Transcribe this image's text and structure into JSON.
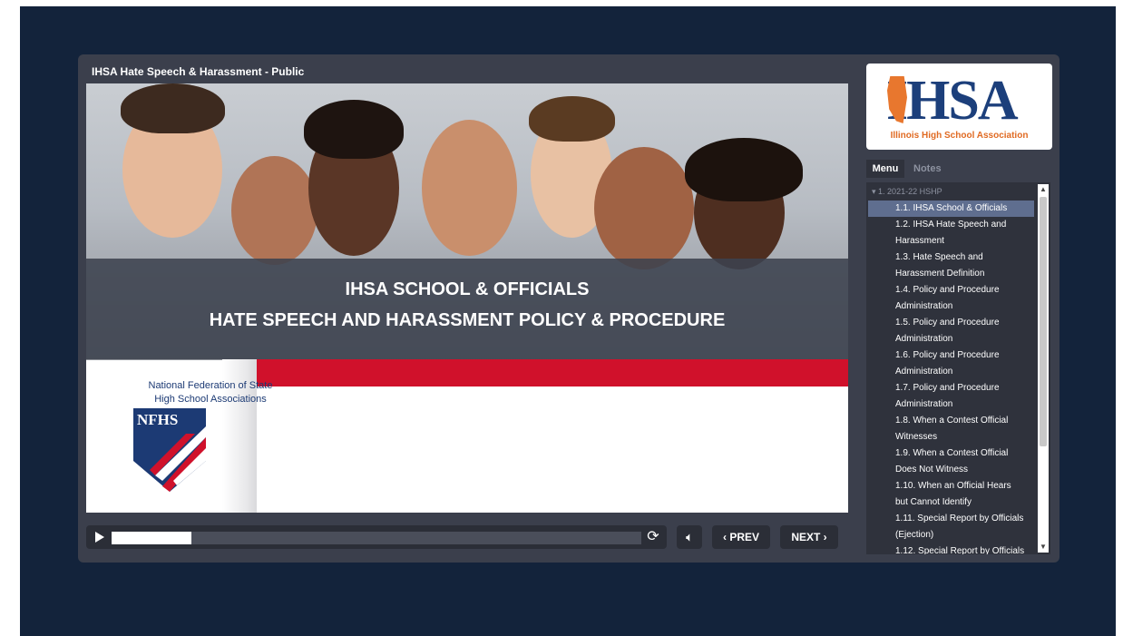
{
  "window": {
    "title": "IHSA Hate Speech & Harassment - Public"
  },
  "slide": {
    "banner_line1": "IHSA SCHOOL & OFFICIALS",
    "banner_line2": "HATE SPEECH AND HARASSMENT POLICY & PROCEDURE",
    "nfhs_text_line1": "National Federation of State",
    "nfhs_text_line2": "High School Associations",
    "nfhs_logo_text": "NFHS"
  },
  "controls": {
    "progress_fraction": 0.15,
    "prev_label": "‹ PREV",
    "next_label": "NEXT ›",
    "play_icon": "play-icon",
    "replay_icon": "replay-icon",
    "volume_icon": "volume-icon"
  },
  "sidebar": {
    "logo_text": "IHSA",
    "logo_sub": "Illinois High School Association",
    "tabs": [
      {
        "label": "Menu"
      },
      {
        "label": "Notes"
      }
    ],
    "section": "1. 2021-22 HSHP",
    "items": [
      {
        "line1": "1.1. IHSA School & Officials",
        "line2": ""
      },
      {
        "line1": "1.2. IHSA Hate Speech and",
        "line2": "Harassment"
      },
      {
        "line1": "1.3. Hate Speech and",
        "line2": "Harassment Definition"
      },
      {
        "line1": "1.4. Policy and Procedure",
        "line2": "Administration"
      },
      {
        "line1": "1.5. Policy and Procedure",
        "line2": "Administration"
      },
      {
        "line1": "1.6. Policy and Procedure",
        "line2": "Administration"
      },
      {
        "line1": "1.7. Policy and Procedure",
        "line2": "Administration"
      },
      {
        "line1": "1.8. When a Contest Official",
        "line2": "Witnesses"
      },
      {
        "line1": "1.9. When a Contest Official",
        "line2": "Does Not Witness"
      },
      {
        "line1": "1.10. When an Official Hears",
        "line2": "but Cannot Identify"
      },
      {
        "line1": "1.11. Special Report by Officials",
        "line2": "(Ejection)"
      },
      {
        "line1": "1.12. Special Report by Officials",
        "line2": ""
      }
    ]
  },
  "colors": {
    "background": "#13233b",
    "player": "#3b3f4c",
    "accent_red": "#d0112b",
    "ihsa_blue": "#1c3f7b",
    "ihsa_orange": "#e06a22"
  }
}
